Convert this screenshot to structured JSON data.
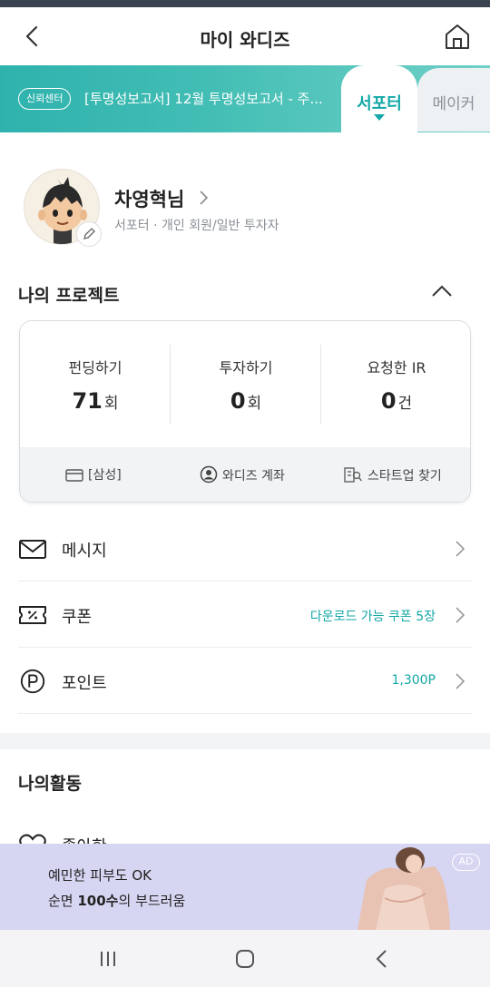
{
  "header": {
    "title": "마이 와디즈",
    "back_icon": "chevron-left-icon",
    "home_icon": "home-icon"
  },
  "banner": {
    "badge": "신뢰센터",
    "notice": "[투명성보고서] 12월 투명성보고서 - 주...",
    "tabs": [
      {
        "label": "서포터",
        "active": true
      },
      {
        "label": "메이커",
        "active": false
      }
    ],
    "accent": "#14a8a8"
  },
  "profile": {
    "name": "차영혁님",
    "subtitle": "서포터 · 개인 회원/일반 투자자"
  },
  "my_projects": {
    "title": "나의 프로젝트",
    "stats": [
      {
        "label": "펀딩하기",
        "value": "71",
        "unit": "회"
      },
      {
        "label": "투자하기",
        "value": "0",
        "unit": "회"
      },
      {
        "label": "요청한 IR",
        "value": "0",
        "unit": "건"
      }
    ],
    "footer": [
      {
        "icon": "card-icon",
        "label": "[삼성]"
      },
      {
        "icon": "user-circle-icon",
        "label": "와디즈 계좌"
      },
      {
        "icon": "building-search-icon",
        "label": "스타트업 찾기"
      }
    ]
  },
  "menu": [
    {
      "icon": "mail-icon",
      "label": "메시지",
      "value": ""
    },
    {
      "icon": "coupon-icon",
      "label": "쿠폰",
      "value": "다운로드 가능 쿠폰 5장"
    },
    {
      "icon": "point-icon",
      "label": "포인트",
      "value": "1,300P"
    }
  ],
  "activity": {
    "title": "나의활동",
    "first_item": "좋아한"
  },
  "ad": {
    "line1": "예민한 피부도 OK",
    "line2_a": "순면 ",
    "line2_b": "100수",
    "line2_c": "의 부드러움",
    "badge": "AD"
  },
  "navbar": {
    "icons": [
      "recent-apps-icon",
      "home-circle-icon",
      "back-icon"
    ]
  }
}
